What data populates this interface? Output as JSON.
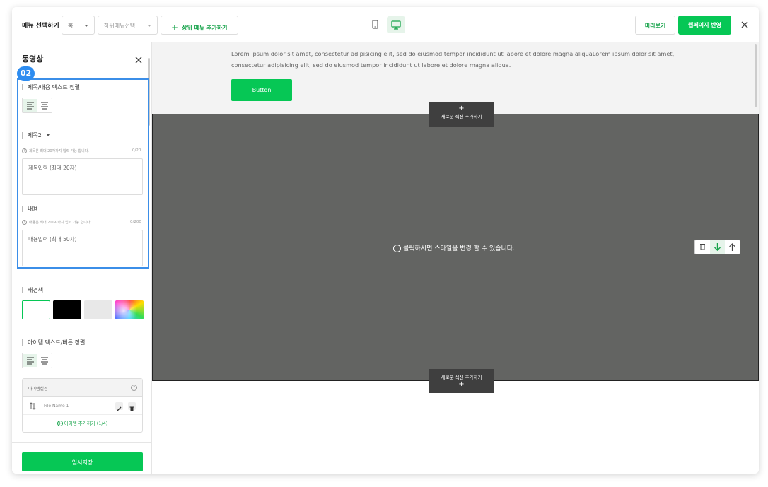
{
  "topbar": {
    "menu_label": "메뉴 선택하기",
    "menu_select": "홈",
    "submenu_placeholder": "하위메뉴선택",
    "add_menu": "상위 메뉴 추가하기",
    "preview": "미리보기",
    "publish": "웹페이지 반영"
  },
  "sidebar": {
    "title": "동영상",
    "step_badge": "02",
    "title_align_label": "제목/내용 텍스트 정렬",
    "heading_select": "제목2",
    "title_hint": "제목은 최대 20자까지 입력 가능 합니다.",
    "title_count": "0/20",
    "title_placeholder": "제목입력 (최대 20자)",
    "content_label": "내용",
    "content_hint": "내용은 최대 200자까지 입력 가능 합니다.",
    "content_count": "0/200",
    "content_placeholder": "내용입력 (최대 50자)",
    "bg_label": "배경색",
    "bg_colors": [
      "#ffffff",
      "#000000",
      "#e8e8e8",
      "rainbow"
    ],
    "item_align_label": "아이템 텍스트/버튼 정렬",
    "item_settings": "아이템설정",
    "item_name": "File Name 1",
    "add_item": "아이템 추가하기 (1/4)",
    "save": "임시저장"
  },
  "canvas": {
    "lorem": "Lorem ipsum dolor sit amet, consectetur adipisicing elit, sed do eiusmod tempor incididunt ut labore et dolore magna aliquaLorem ipsum dolor sit amet, consectetur adipisicing elit, sed do eiusmod tempor incididunt ut labore et dolore magna aliqua.",
    "button": "Button",
    "add_section": "새로운 섹션 추가하기",
    "style_msg": "클릭하시면 스타일을 변경 할 수 있습니다."
  },
  "colors": {
    "brand_green": "#06c755",
    "highlight_blue": "#3b8ee8",
    "section_gray": "#636462"
  }
}
